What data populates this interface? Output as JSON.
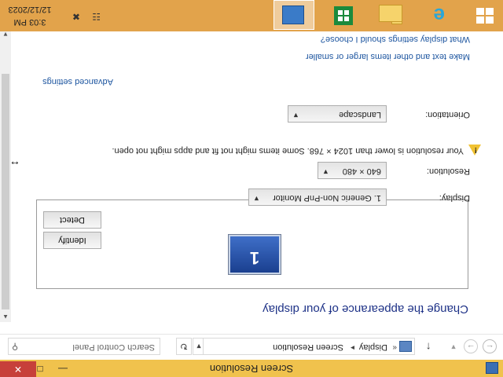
{
  "window": {
    "title": "Screen Resolution"
  },
  "address_bar": {
    "breadcrumb": [
      "Display",
      "Screen Resolution"
    ],
    "crumb_separator": "▸",
    "crumb_lead": "«",
    "search_placeholder": "Search Control Panel"
  },
  "content": {
    "heading": "Change the appearance of your display",
    "identify_label": "Identify",
    "detect_label": "Detect",
    "monitor_number": "1",
    "display_label": "Display:",
    "display_value": "1. Generic Non-PnP Monitor",
    "resolution_label": "Resolution:",
    "resolution_value": "640 × 480",
    "warning_text": "Your resolution is lower than 1024 × 768. Some items might not fit and apps might not open.",
    "orientation_label": "Orientation:",
    "orientation_value": "Landscape",
    "advanced_link": "Advanced settings",
    "text_size_link": "Make text and other items larger or smaller",
    "help_link": "What display settings should I choose?"
  },
  "taskbar": {
    "clock_time": "3:03 PM",
    "clock_date": "12/12/2023"
  },
  "colors": {
    "titlebar": "#f0c24d",
    "taskbar": "#e2a34b",
    "heading": "#1e3287",
    "link": "#1e56a0",
    "close": "#c7403a"
  }
}
